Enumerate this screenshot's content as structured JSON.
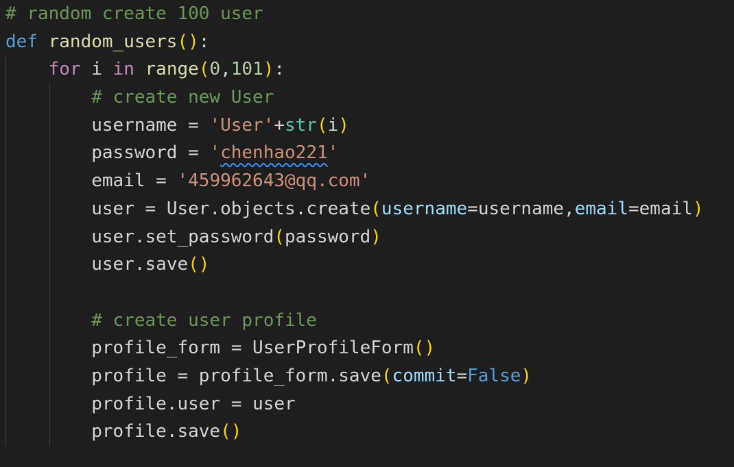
{
  "editor": {
    "lines": [
      {
        "comment": "# random create 100 user"
      },
      {
        "kw": "def",
        "name": "random_users",
        "open": "(",
        "close": ")",
        "colon": ":"
      },
      {
        "kw": "for",
        "var": "i",
        "in": "in",
        "fn": "range",
        "open": "(",
        "a": "0",
        "comma": ",",
        "b": "101",
        "close": ")",
        "colon": ":"
      },
      {
        "comment": "# create new User"
      },
      {
        "var": "username",
        "eq": "=",
        "str": "'User'",
        "plus": "+",
        "fn": "str",
        "open": "(",
        "arg": "i",
        "close": ")"
      },
      {
        "var": "password",
        "eq": "=",
        "q1": "'",
        "str": "chenhao221",
        "q2": "'"
      },
      {
        "var": "email",
        "eq": "=",
        "str": "'459962643@qq.com'"
      },
      {
        "var": "user",
        "eq": "=",
        "obj": "User",
        "dot1": ".",
        "attr": "objects",
        "dot2": ".",
        "fn": "create",
        "open": "(",
        "p1": "username",
        "e1": "=",
        "v1": "username",
        "comma": ",",
        "p2": "email",
        "e2": "=",
        "v2": "email",
        "close": ")"
      },
      {
        "obj": "user",
        "dot": ".",
        "fn": "set_password",
        "open": "(",
        "arg": "password",
        "close": ")"
      },
      {
        "obj": "user",
        "dot": ".",
        "fn": "save",
        "open": "(",
        "close": ")"
      },
      {},
      {
        "comment": "# create user profile"
      },
      {
        "var": "profile_form",
        "eq": "=",
        "fn": "UserProfileForm",
        "open": "(",
        "close": ")"
      },
      {
        "var": "profile",
        "eq": "=",
        "obj": "profile_form",
        "dot": ".",
        "fn": "save",
        "open": "(",
        "p": "commit",
        "e": "=",
        "val": "False",
        "close": ")"
      },
      {
        "obj": "profile",
        "dot": ".",
        "attr": "user",
        "eq": "=",
        "val": "user"
      },
      {
        "obj": "profile",
        "dot": ".",
        "fn": "save",
        "open": "(",
        "close": ")"
      }
    ]
  }
}
